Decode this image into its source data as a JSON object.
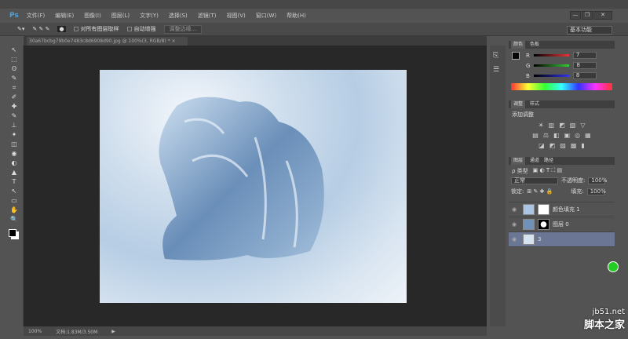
{
  "app": {
    "logo": "Ps"
  },
  "menu": [
    "文件(F)",
    "编辑(E)",
    "图像(I)",
    "图层(L)",
    "文字(Y)",
    "选择(S)",
    "滤镜(T)",
    "视图(V)",
    "窗口(W)",
    "帮助(H)"
  ],
  "window": {
    "minimize": "—",
    "restore": "❐",
    "close": "✕"
  },
  "options": {
    "sample_all": "对所有图层取样",
    "auto_enhance": "自动增强",
    "refine_edge": "调整边缘..."
  },
  "workspace": "基本功能",
  "document": {
    "tab": "30a67bcbg79b0e7483c8d6908d90.jpg @ 100%(3, RGB/8) *",
    "close": "×"
  },
  "status": {
    "zoom": "100%",
    "doc_size": "文档:1.83M/3.50M"
  },
  "color_panel": {
    "tabs": [
      "颜色",
      "色板"
    ],
    "r_label": "R",
    "g_label": "G",
    "b_label": "B",
    "r": "7",
    "g": "8",
    "b": "8"
  },
  "adjust_panel": {
    "tabs": [
      "调整",
      "样式"
    ],
    "title": "添加调整"
  },
  "layers_panel": {
    "tabs": [
      "图层",
      "通道",
      "路径"
    ],
    "kind": "ρ 类型",
    "blend": "正常",
    "opacity_label": "不透明度:",
    "opacity": "100%",
    "lock_label": "锁定:",
    "fill_label": "填充:",
    "fill": "100%",
    "layers": [
      {
        "name": "颜色填充 1",
        "selected": false
      },
      {
        "name": "图层 0",
        "selected": false
      },
      {
        "name": "3",
        "selected": true
      }
    ]
  },
  "watermark": {
    "site": "jb51.net",
    "name": "脚本之家"
  },
  "tools": [
    "↖",
    "⬚",
    "ʘ",
    "✎",
    "⌗",
    "✐",
    "✚",
    "✎",
    "⊥",
    "✦",
    "◫",
    "◉",
    "◐",
    "▲",
    "T",
    "↖",
    "▭",
    "✋",
    "🔍"
  ]
}
